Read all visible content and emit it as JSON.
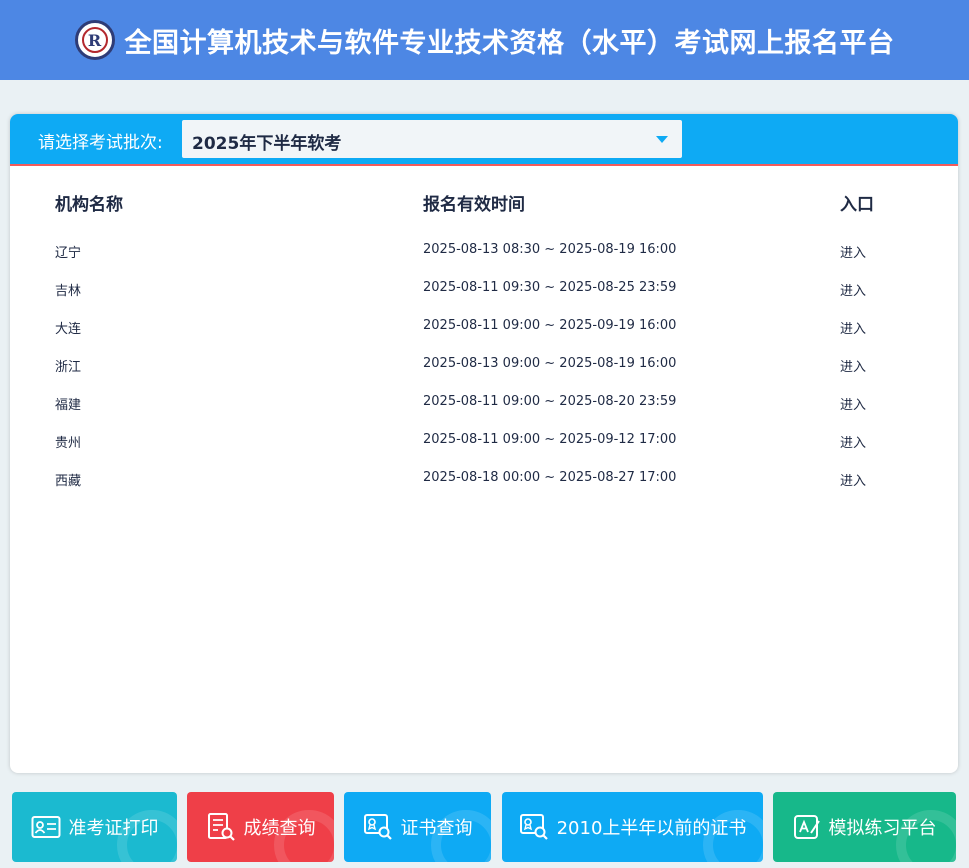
{
  "header": {
    "title": "全国计算机技术与软件专业技术资格（水平）考试网上报名平台",
    "logo_letter": "R"
  },
  "batch": {
    "label": "请选择考试批次:",
    "selected": "2025年下半年软考"
  },
  "table": {
    "columns": [
      "机构名称",
      "报名有效时间",
      "入口"
    ],
    "rows": [
      {
        "org": "辽宁",
        "time": "2025-08-13 08:30 ~ 2025-08-19 16:00",
        "entry": "进入"
      },
      {
        "org": "吉林",
        "time": "2025-08-11 09:30 ~ 2025-08-25 23:59",
        "entry": "进入"
      },
      {
        "org": "大连",
        "time": "2025-08-11 09:00 ~ 2025-09-19 16:00",
        "entry": "进入"
      },
      {
        "org": "浙江",
        "time": "2025-08-13 09:00 ~ 2025-08-19 16:00",
        "entry": "进入"
      },
      {
        "org": "福建",
        "time": "2025-08-11 09:00 ~ 2025-08-20 23:59",
        "entry": "进入"
      },
      {
        "org": "贵州",
        "time": "2025-08-11 09:00 ~ 2025-09-12 17:00",
        "entry": "进入"
      },
      {
        "org": "西藏",
        "time": "2025-08-18 00:00 ~ 2025-08-27 17:00",
        "entry": "进入"
      }
    ]
  },
  "footer": {
    "buttons": [
      {
        "label": "准考证打印",
        "icon": "id-card-icon",
        "color": "#1bbad0"
      },
      {
        "label": "成绩查询",
        "icon": "score-search-icon",
        "color": "#ef3f48"
      },
      {
        "label": "证书查询",
        "icon": "certificate-search-icon",
        "color": "#0eaaf4"
      },
      {
        "label": "2010上半年以前的证书",
        "icon": "old-certificate-search-icon",
        "color": "#0eaaf4"
      },
      {
        "label": "模拟练习平台",
        "icon": "practice-edit-icon",
        "color": "#17b88a"
      }
    ]
  },
  "colors": {
    "header_bg": "#4d87e4",
    "batch_bar_bg": "#0eaaf4",
    "batch_bar_underline": "#f35b5b",
    "page_bg": "#eaf1f4"
  }
}
